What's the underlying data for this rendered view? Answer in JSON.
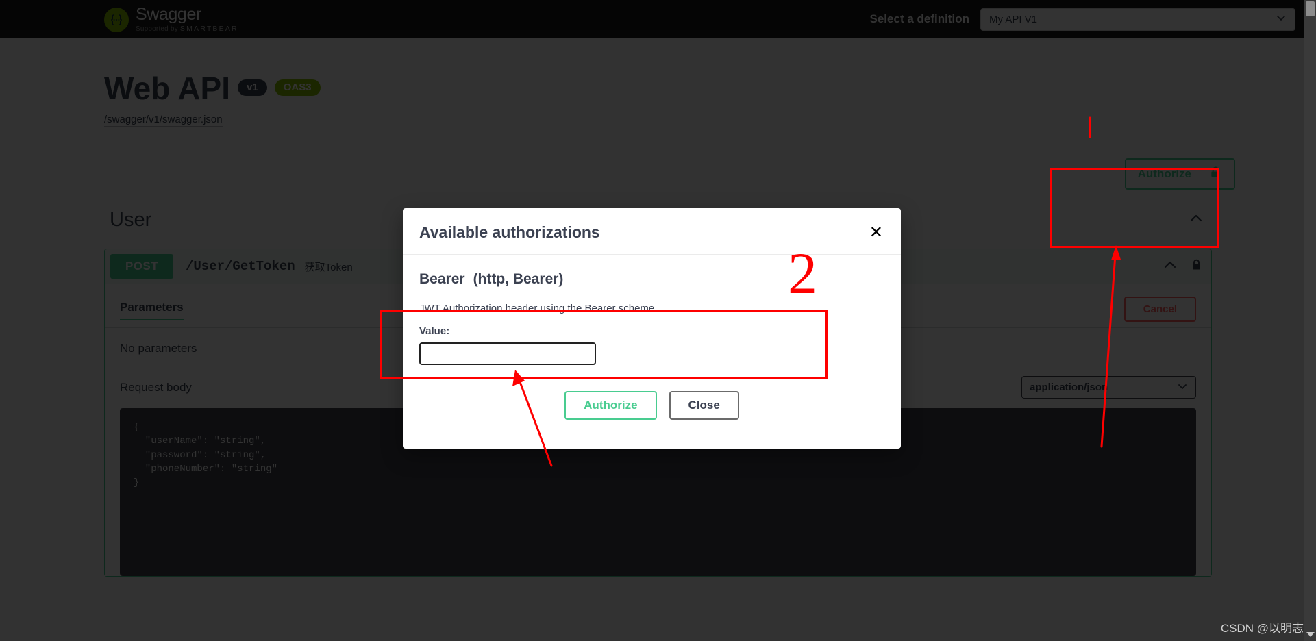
{
  "topbar": {
    "logo_title": "Swagger",
    "logo_supported_prefix": "Supported by ",
    "logo_supported_brand": "SMARTBEAR",
    "definition_label": "Select a definition",
    "definition_value": "My API V1"
  },
  "info": {
    "title": "Web API",
    "version_badge": "v1",
    "oas_badge": "OAS3",
    "spec_url": "/swagger/v1/swagger.json"
  },
  "auth": {
    "authorize_button": "Authorize",
    "lock_icon": "lock-open-icon"
  },
  "tag": {
    "name": "User",
    "collapse_icon": "chevron-up-icon"
  },
  "operation": {
    "method": "POST",
    "path": "/User/GetToken",
    "summary": "获取Token",
    "collapse_icon": "chevron-up-icon",
    "lock_icon": "lock-closed-icon",
    "parameters_tab": "Parameters",
    "cancel_button": "Cancel",
    "no_parameters": "No parameters",
    "request_body_label": "Request body",
    "content_type": "application/json",
    "content_type_icon": "chevron-down-icon",
    "example_body": "{\n  \"userName\": \"string\",\n  \"password\": \"string\",\n  \"phoneNumber\": \"string\"\n}"
  },
  "modal": {
    "title": "Available authorizations",
    "close_icon": "close-icon",
    "scheme_name": "Bearer",
    "scheme_kind": "(http, Bearer)",
    "scheme_description": "JWT Authorization header using the Bearer scheme",
    "value_label": "Value:",
    "value_input": "",
    "value_placeholder": "",
    "authorize_button": "Authorize",
    "close_button": "Close"
  },
  "annotations": {
    "step_number": "2",
    "color": "#fe0000"
  },
  "watermark": "CSDN @以明志"
}
